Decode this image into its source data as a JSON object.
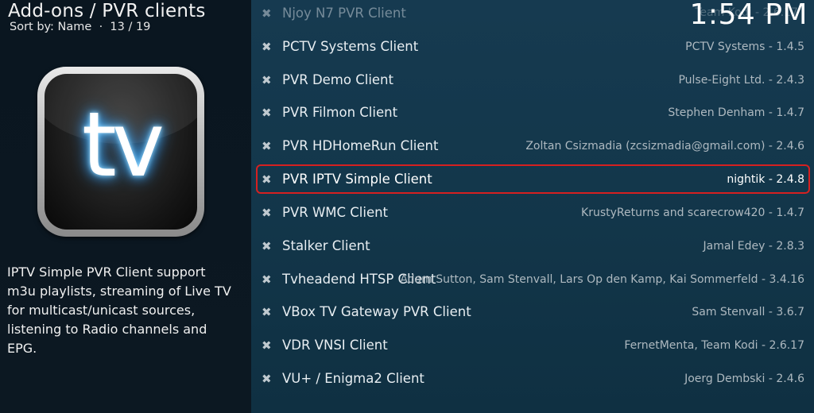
{
  "header": {
    "title": "Add-ons / PVR clients",
    "sort_label": "Sort by: Name",
    "separator": "·",
    "position": "13 / 19",
    "clock": "1:54 PM",
    "clock_overlap_text": "Team Kodi - 2.6.17"
  },
  "addon": {
    "icon_text": "tv",
    "description": "IPTV Simple PVR Client support m3u playlists, streaming of Live TV for multicast/unicast sources, listening to Radio channels and EPG."
  },
  "list": {
    "items": [
      {
        "name": "Njoy N7 PVR Client",
        "meta": ""
      },
      {
        "name": "PCTV Systems Client",
        "meta": "PCTV Systems - 1.4.5"
      },
      {
        "name": "PVR Demo Client",
        "meta": "Pulse-Eight Ltd. - 2.4.3"
      },
      {
        "name": "PVR Filmon Client",
        "meta": "Stephen Denham - 1.4.7"
      },
      {
        "name": "PVR HDHomeRun Client",
        "meta": "Zoltan Csizmadia (zcsizmadia@gmail.com) - 2.4.6"
      },
      {
        "name": "PVR IPTV Simple Client",
        "meta": "nightik - 2.4.8"
      },
      {
        "name": "PVR WMC Client",
        "meta": "KrustyReturns and scarecrow420 - 1.4.7"
      },
      {
        "name": "Stalker Client",
        "meta": "Jamal Edey - 2.8.3"
      },
      {
        "name": "Tvheadend HTSP Client",
        "meta": "Adam Sutton, Sam Stenvall, Lars Op den Kamp, Kai Sommerfeld - 3.4.16"
      },
      {
        "name": "VBox TV Gateway PVR Client",
        "meta": "Sam Stenvall - 3.6.7"
      },
      {
        "name": "VDR VNSI Client",
        "meta": "FernetMenta, Team Kodi - 2.6.17"
      },
      {
        "name": "VU+ / Enigma2 Client",
        "meta": "Joerg Dembski - 2.4.6"
      }
    ],
    "status_icon": "close-icon",
    "status_glyph": "✖",
    "selected_index": 5,
    "highlight_color": "#d62020"
  }
}
